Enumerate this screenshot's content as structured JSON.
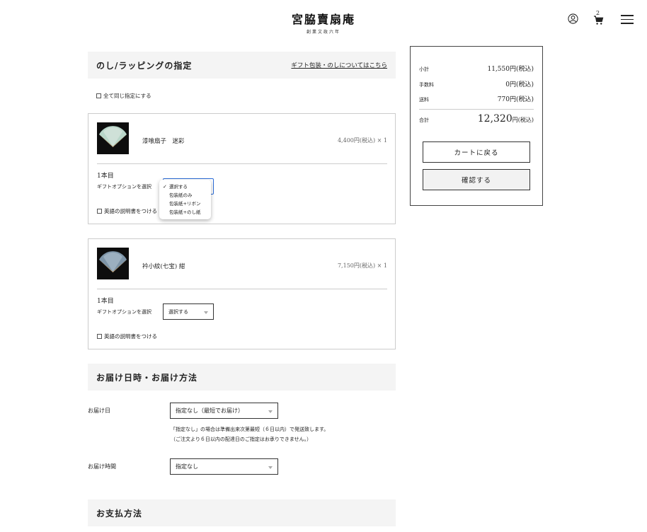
{
  "header": {
    "logo_main": "宮脇賣扇庵",
    "logo_sub": "創業文政六年",
    "cart_count": "2"
  },
  "wrapping": {
    "title": "のし/ラッピングの指定",
    "link": "ギフト包装・のしについてはこちら",
    "same_all_label": "全て同じ指定にする"
  },
  "items": [
    {
      "name": "漆喰扇子　迷彩",
      "price": "4,400円(税込) × 1",
      "index_label": "1本目",
      "option_label": "ギフトオプションを選択",
      "selected": "選択する",
      "english_label": "英語の説明書をつける"
    },
    {
      "name": "衿小紋(七宝) 紺",
      "price": "7,150円(税込) × 1",
      "index_label": "1本目",
      "option_label": "ギフトオプションを選択",
      "selected": "選択する",
      "english_label": "英語の説明書をつける"
    }
  ],
  "dropdown_options": [
    "選択する",
    "包装紙のみ",
    "包装紙+リボン",
    "包装紙+のし紙"
  ],
  "delivery": {
    "title": "お届け日時・お届け方法",
    "date_label": "お届け日",
    "date_value": "指定なし（最短でお届け）",
    "note_1": "「指定なし」の場合は準備出来次第最短（６日以内）で発送致します。",
    "note_2": "（ご注文より６日以内の配達日のご指定はお承りできません。）",
    "time_label": "お届け時間",
    "time_value": "指定なし"
  },
  "payment": {
    "title": "お支払方法"
  },
  "summary": {
    "subtotal_label": "小計",
    "subtotal_value": "11,550円(税込)",
    "fee_label": "手数料",
    "fee_value": "0円(税込)",
    "shipping_label": "送料",
    "shipping_value": "770円(税込)",
    "total_label": "合計",
    "total_value": "12,320",
    "total_suffix": "円(税込)",
    "back_button": "カートに戻る",
    "confirm_button": "確認する"
  }
}
